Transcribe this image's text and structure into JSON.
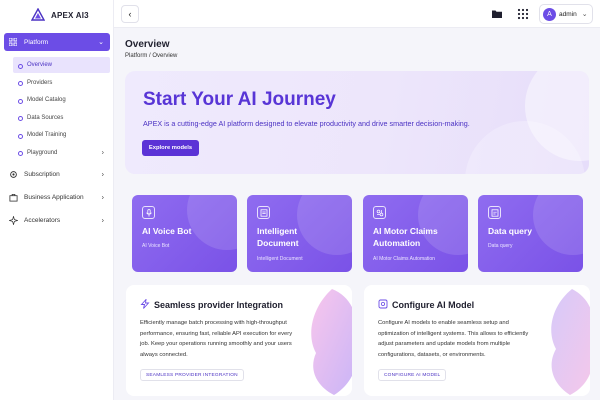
{
  "app": {
    "name": "APEX AI3"
  },
  "sidebar": {
    "items": [
      {
        "label": "Platform",
        "icon": "grid-icon",
        "active": true
      },
      {
        "label": "Subscription",
        "icon": "gear-icon"
      },
      {
        "label": "Business Application",
        "icon": "briefcase-icon"
      },
      {
        "label": "Accelerators",
        "icon": "sparkle-icon"
      }
    ],
    "sub": [
      {
        "label": "Overview",
        "active": true
      },
      {
        "label": "Providers"
      },
      {
        "label": "Model Catalog"
      },
      {
        "label": "Data Sources"
      },
      {
        "label": "Model Training"
      },
      {
        "label": "Playground"
      }
    ]
  },
  "topbar": {
    "user": "admin",
    "avatar_letter": "A"
  },
  "page": {
    "title": "Overview",
    "breadcrumb": "Platform / Overview"
  },
  "hero": {
    "title": "Start Your AI Journey",
    "description": "APEX is a cutting-edge AI platform designed to elevate productivity and drive smarter decision-making.",
    "button": "Explore models"
  },
  "cards": [
    {
      "title": "AI Voice Bot",
      "subtitle": "AI Voice Bot",
      "icon": "microphone-icon"
    },
    {
      "title_1": "Intelligent",
      "title_2": "Document",
      "subtitle": "Intelligent Document",
      "icon": "document-icon"
    },
    {
      "title_1": "AI Motor Claims",
      "title_2": "Automation",
      "subtitle": "AI Motor Claims Automation",
      "icon": "automation-icon"
    },
    {
      "title": "Data query",
      "subtitle": "Data query",
      "icon": "database-icon"
    }
  ],
  "features": [
    {
      "title": "Seamless provider Integration",
      "description": "Efficiently manage batch processing with high-throughput performance, ensuring fast, reliable API execution for every job. Keep your operations running smoothly and your users always connected.",
      "link": "SEAMLESS PROVIDER INTEGRATION",
      "icon": "lightning-icon"
    },
    {
      "title": "Configure AI Model",
      "description": "Configure AI models to enable seamless setup and optimization of intelligent systems. This allows to efficiently adjust parameters and update models from multiple configurations, datasets, or environments.",
      "link": "CONFIGURE AI MODEL",
      "icon": "settings-cube-icon"
    }
  ],
  "colors": {
    "accent": "#6c4de6",
    "hero_title": "#5835d6",
    "card": "#8060ea"
  }
}
